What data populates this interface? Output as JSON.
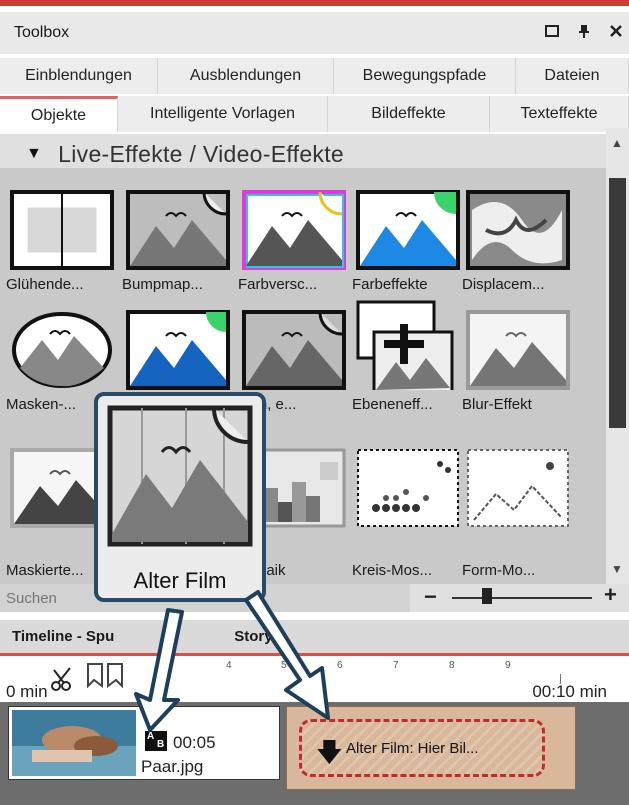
{
  "toolbox": {
    "title": "Toolbox",
    "window_buttons": [
      "maximize-icon",
      "pin-icon",
      "close-icon"
    ],
    "tabs_row1": [
      "Einblendungen",
      "Ausblendungen",
      "Bewegungspfade",
      "Dateien"
    ],
    "tabs_row2": [
      "Objekte",
      "Intelligente Vorlagen",
      "Bildeffekte",
      "Texteffekte"
    ],
    "active_tab": "Objekte",
    "group_title": "Live-Effekte / Video-Effekte",
    "effects": [
      {
        "label": "Glühende..."
      },
      {
        "label": "Bumpmap..."
      },
      {
        "label": "Farbversc..."
      },
      {
        "label": "Farbeffekte"
      },
      {
        "label": "Displacem..."
      },
      {
        "label": "Masken-..."
      },
      {
        "label": ""
      },
      {
        "label": "bton, e..."
      },
      {
        "label": "Ebeneneff..."
      },
      {
        "label": "Blur-Effekt"
      },
      {
        "label": "Maskierte..."
      },
      {
        "label": ""
      },
      {
        "label": "Mosaik"
      },
      {
        "label": "Kreis-Mos..."
      },
      {
        "label": "Form-Mo..."
      }
    ],
    "search_placeholder": "Suchen",
    "zoom_level": 0.2
  },
  "tooltip": {
    "label": "Alter Film"
  },
  "timeline": {
    "title": "Timeline - Spu",
    "title_right": "Story",
    "ruler_ticks": [
      "4",
      "5",
      "6",
      "7",
      "8",
      "9"
    ],
    "time_left": "0 min",
    "time_right": "00:10 min",
    "clip": {
      "duration": "00:05",
      "name": "Paar.jpg"
    },
    "drop_target_text": "Alter Film: Hier Bil..."
  }
}
